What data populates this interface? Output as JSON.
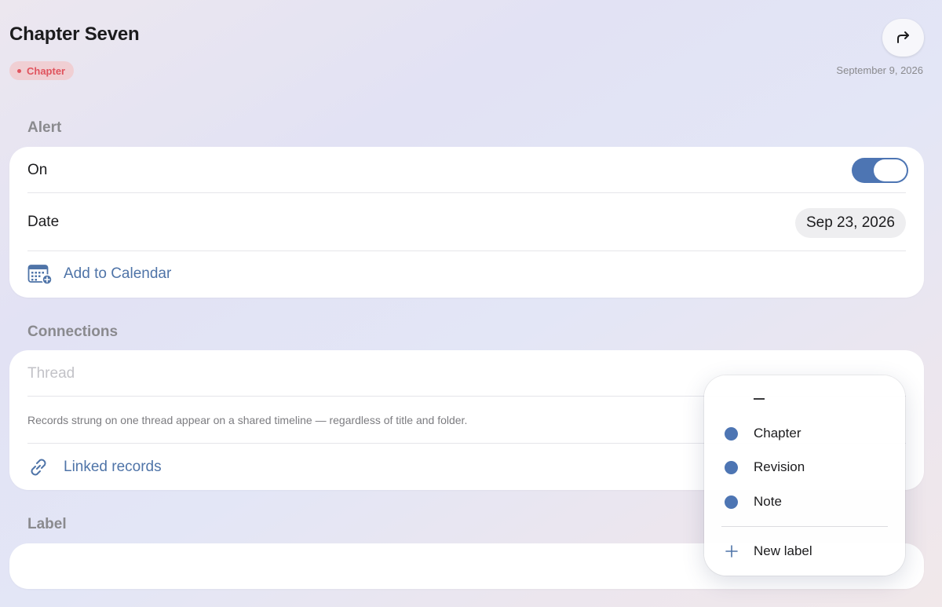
{
  "header": {
    "title": "Chapter Seven",
    "tag_label": "Chapter",
    "date": "September 9, 2026",
    "share_icon": "share-arrow-icon"
  },
  "alert": {
    "section_label": "Alert",
    "on_label": "On",
    "toggle_on": true,
    "date_label": "Date",
    "date_value": "Sep 23, 2026",
    "add_to_calendar": "Add to Calendar"
  },
  "connections": {
    "section_label": "Connections",
    "thread_placeholder": "Thread",
    "caption": "Records strung on one thread appear on a shared timeline — regardless of title and folder.",
    "linked_records": "Linked records"
  },
  "label": {
    "section_label": "Label"
  },
  "label_menu": {
    "none_item": "–",
    "items": [
      "Chapter",
      "Revision",
      "Note"
    ],
    "new_label": "New label"
  },
  "colors": {
    "accent": "#4d75b3",
    "tag_text": "#e0545e",
    "tag_bg": "#f0cfd3",
    "link": "#4f74a8"
  }
}
